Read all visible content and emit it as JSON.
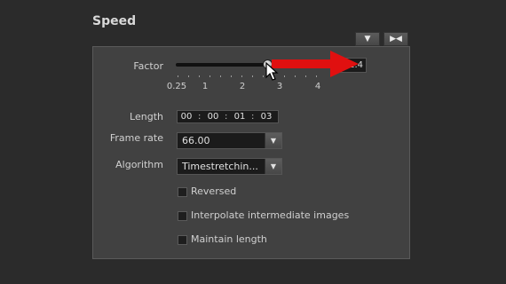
{
  "section": {
    "title": "Speed"
  },
  "header_buttons": {
    "dropdown_icon": "triangle-down",
    "collapse_icon": "collapse-arrows"
  },
  "factor": {
    "label": "Factor",
    "field_value": "1.4",
    "ticks": [
      "0.25",
      "1",
      "2",
      "3",
      "4"
    ]
  },
  "length": {
    "label": "Length",
    "segments": [
      "00",
      "00",
      "01",
      "03"
    ],
    "separator": ":"
  },
  "frame_rate": {
    "label": "Frame rate",
    "value": "66.00"
  },
  "algorithm": {
    "label": "Algorithm",
    "value": "Timestretchin..."
  },
  "options": [
    {
      "label": "Reversed",
      "checked": false
    },
    {
      "label": "Interpolate intermediate images",
      "checked": false
    },
    {
      "label": "Maintain length",
      "checked": false
    }
  ],
  "colors": {
    "annotation_arrow": "#e01010",
    "panel_bg": "#414141",
    "page_bg": "#2b2b2b"
  }
}
